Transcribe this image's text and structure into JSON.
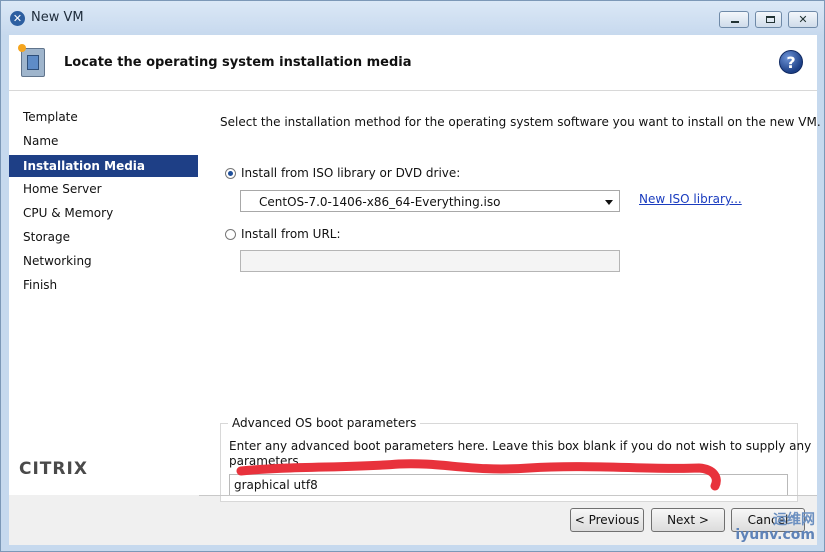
{
  "window": {
    "title": "New VM"
  },
  "header": {
    "title": "Locate the operating system installation media"
  },
  "sidebar": {
    "items": [
      {
        "label": "Template"
      },
      {
        "label": "Name"
      },
      {
        "label": "Installation Media",
        "selected": true
      },
      {
        "label": "Home Server"
      },
      {
        "label": "CPU & Memory"
      },
      {
        "label": "Storage"
      },
      {
        "label": "Networking"
      },
      {
        "label": "Finish"
      }
    ],
    "logo": "CITRIX"
  },
  "main": {
    "instruction": "Select the installation method for the operating system software you want to install on the new VM.",
    "iso_option": {
      "label": "Install from ISO library or DVD drive:",
      "selected": true
    },
    "iso_select": {
      "value": "CentOS-7.0-1406-x86_64-Everything.iso"
    },
    "new_iso_link": "New ISO library...",
    "url_option": {
      "label": "Install from URL:",
      "selected": false
    },
    "url_input": {
      "value": ""
    },
    "boot": {
      "title": "Advanced OS boot parameters",
      "description_line1": "Enter any advanced boot parameters here. Leave this box blank if you do not wish to supply any",
      "description_line2": "parameters.",
      "value": "graphical utf8"
    }
  },
  "buttons": {
    "previous": "< Previous",
    "next": "Next >",
    "cancel": "Cancel"
  },
  "watermark": {
    "top": "运维网",
    "bottom": "iyunv.com"
  },
  "colors": {
    "selection": "#1e3f86",
    "link": "#1a3cbf",
    "annotation": "#e8323c"
  },
  "icons": [
    "new-vm-icon",
    "wizard-icon",
    "help-icon",
    "chevron-down-icon",
    "citrix-logo"
  ]
}
